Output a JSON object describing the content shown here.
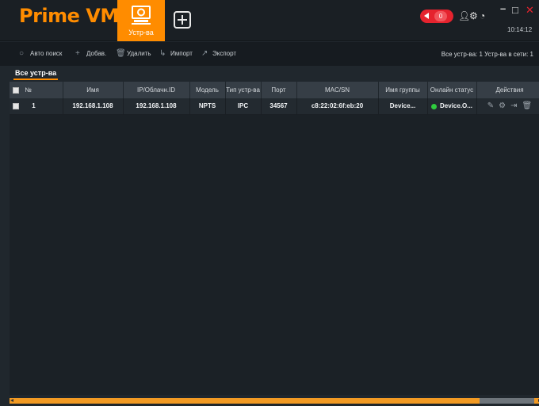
{
  "app": {
    "title": "Prime VMS"
  },
  "tabs": [
    {
      "label": "Устр-ва",
      "icon": "device-manager-icon",
      "active": true
    },
    {
      "label": "",
      "icon": "add-tab-icon"
    }
  ],
  "header": {
    "alarm_count": "0",
    "clock": "10:14:12",
    "accent_color": "#ff8c00",
    "alarm_color": "#e5232e"
  },
  "toolbar": {
    "auto_search": "Авто поиск",
    "add": "Добав.",
    "delete": "Удалить",
    "import": "Импорт",
    "export": "Экспорт",
    "summary": "Все устр-ва: 1  Устр-ва в сети: 1"
  },
  "subtab": {
    "label": "Все устр-ва"
  },
  "table": {
    "headers": [
      "№",
      "Имя",
      "IP/Облачн.ID",
      "Модель",
      "Тип устр-ва",
      "Порт",
      "MAC/SN",
      "Имя группы",
      "Онлайн статус",
      "Действия"
    ],
    "rows": [
      {
        "no": "1",
        "name": "192.168.1.108",
        "ip": "192.168.1.108",
        "model": "NPTS",
        "type": "IPC",
        "port": "34567",
        "mac": "c8:22:02:6f:eb:20",
        "group": "Device...",
        "status": "Device.O...",
        "status_color": "#2fcc3e"
      }
    ]
  },
  "scrollbar": {
    "position": 0.88
  }
}
